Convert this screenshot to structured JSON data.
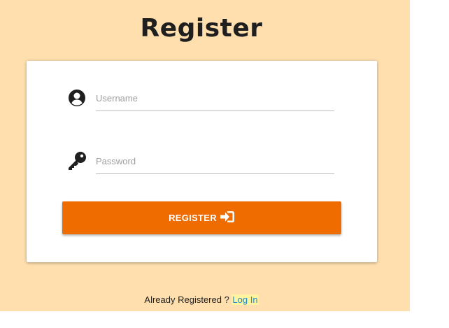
{
  "page": {
    "title": "Register"
  },
  "form": {
    "username": {
      "placeholder": "Username",
      "value": "",
      "icon": "user-circle-icon"
    },
    "password": {
      "placeholder": "Password",
      "value": "",
      "icon": "key-icon"
    },
    "submit": {
      "label": "REGISTER",
      "icon": "sign-in-icon"
    }
  },
  "footer": {
    "text": "Already Registered ? ",
    "link_label": "Log In"
  },
  "colors": {
    "background": "#ffdfad",
    "button": "#ee6c00",
    "link": "#1e88c8"
  }
}
